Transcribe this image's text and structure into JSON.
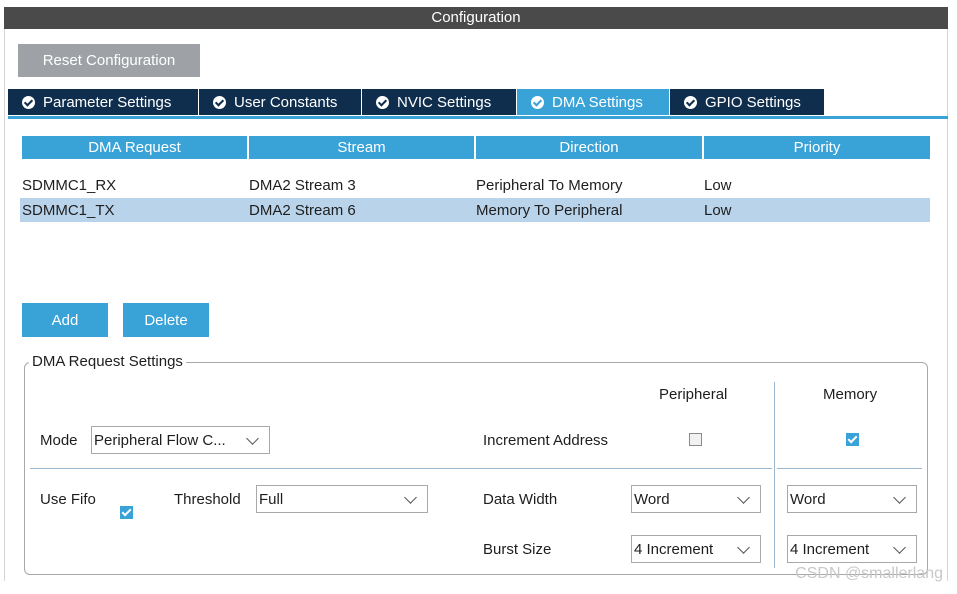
{
  "window": {
    "title": "Configuration"
  },
  "toolbar": {
    "reset_label": "Reset Configuration"
  },
  "tabs": [
    {
      "label": "Parameter Settings"
    },
    {
      "label": "User Constants"
    },
    {
      "label": "NVIC Settings"
    },
    {
      "label": "DMA Settings",
      "active": true
    },
    {
      "label": "GPIO Settings"
    }
  ],
  "table": {
    "headers": [
      "DMA Request",
      "Stream",
      "Direction",
      "Priority"
    ],
    "rows": [
      {
        "request": "SDMMC1_RX",
        "stream": "DMA2 Stream 3",
        "direction": "Peripheral To Memory",
        "priority": "Low"
      },
      {
        "request": "SDMMC1_TX",
        "stream": "DMA2 Stream 6",
        "direction": "Memory To Peripheral",
        "priority": "Low",
        "selected": true
      }
    ]
  },
  "actions": {
    "add_label": "Add",
    "delete_label": "Delete"
  },
  "settings": {
    "title": "DMA Request Settings",
    "peripheral_header": "Peripheral",
    "memory_header": "Memory",
    "mode_label": "Mode",
    "mode_value": "Peripheral Flow C...",
    "increment_label": "Increment Address",
    "peripheral_increment": false,
    "memory_increment": true,
    "use_fifo_label": "Use Fifo",
    "use_fifo": true,
    "threshold_label": "Threshold",
    "threshold_value": "Full",
    "data_width_label": "Data Width",
    "peripheral_data_width": "Word",
    "memory_data_width": "Word",
    "burst_size_label": "Burst Size",
    "peripheral_burst": "4 Increment",
    "memory_burst": "4 Increment"
  },
  "watermark": "CSDN @smallerlang",
  "colors": {
    "accent": "#39a3d8",
    "tab_bg": "#0f2d4d",
    "title_bg": "#4a4a4a",
    "selected_row": "#b9d3ea"
  }
}
